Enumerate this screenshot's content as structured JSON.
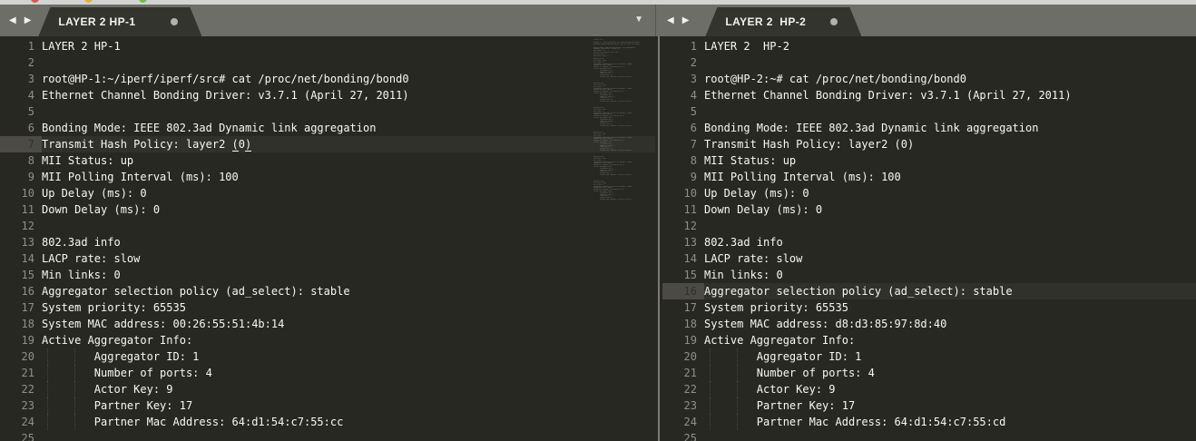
{
  "window": {
    "traffic_lights": [
      {
        "name": "close",
        "color": "#de544d"
      },
      {
        "name": "minimize",
        "color": "#dfb13e"
      },
      {
        "name": "zoom",
        "color": "#73bf47"
      }
    ]
  },
  "theme": {
    "editor_bg": "#272822",
    "text": "#f8f8f2",
    "line_number": "#8f908a",
    "active_gutter_bg": "#4b4b43",
    "active_gutter_num": "#32322c",
    "tab_bar_bg": "#6e6e69",
    "tab_bg": "#34342f",
    "tab_text": "#f2f2ef",
    "modified_dot": "#b2b2ac",
    "top_strip_bg": "#d3d3d1",
    "divider_line": "#7b7b73",
    "indent_guide": "rgba(255,255,255,0.14)"
  },
  "icons": {
    "back": "◀",
    "forward": "▶",
    "overflow": "▼"
  },
  "panes": [
    {
      "tab": {
        "title": "LAYER 2 HP-1",
        "modified": true
      },
      "active_line": 7,
      "bracket_match_line": 7,
      "has_minimap": true,
      "lines": [
        "LAYER 2 HP-1",
        "",
        "root@HP-1:~/iperf/iperf/src# cat /proc/net/bonding/bond0",
        "Ethernet Channel Bonding Driver: v3.7.1 (April 27, 2011)",
        "",
        "Bonding Mode: IEEE 802.3ad Dynamic link aggregation",
        "Transmit Hash Policy: layer2 (0)",
        "MII Status: up",
        "MII Polling Interval (ms): 100",
        "Up Delay (ms): 0",
        "Down Delay (ms): 0",
        "",
        "802.3ad info",
        "LACP rate: slow",
        "Min links: 0",
        "Aggregator selection policy (ad_select): stable",
        "System priority: 65535",
        "System MAC address: 00:26:55:51:4b:14",
        "Active Aggregator Info:",
        "        Aggregator ID: 1",
        "        Number of ports: 4",
        "        Actor Key: 9",
        "        Partner Key: 17",
        "        Partner Mac Address: 64:d1:54:c7:55:cc",
        ""
      ]
    },
    {
      "tab": {
        "title": "LAYER 2  HP-2",
        "modified": true
      },
      "active_line": 16,
      "bracket_match_line": 0,
      "has_minimap": false,
      "lines": [
        "LAYER 2  HP-2",
        "",
        "root@HP-2:~# cat /proc/net/bonding/bond0",
        "Ethernet Channel Bonding Driver: v3.7.1 (April 27, 2011)",
        "",
        "Bonding Mode: IEEE 802.3ad Dynamic link aggregation",
        "Transmit Hash Policy: layer2 (0)",
        "MII Status: up",
        "MII Polling Interval (ms): 100",
        "Up Delay (ms): 0",
        "Down Delay (ms): 0",
        "",
        "802.3ad info",
        "LACP rate: slow",
        "Min links: 0",
        "Aggregator selection policy (ad_select): stable",
        "System priority: 65535",
        "System MAC address: d8:d3:85:97:8d:40",
        "Active Aggregator Info:",
        "        Aggregator ID: 1",
        "        Number of ports: 4",
        "        Actor Key: 9",
        "        Partner Key: 17",
        "        Partner Mac Address: 64:d1:54:c7:55:cd",
        ""
      ]
    }
  ]
}
